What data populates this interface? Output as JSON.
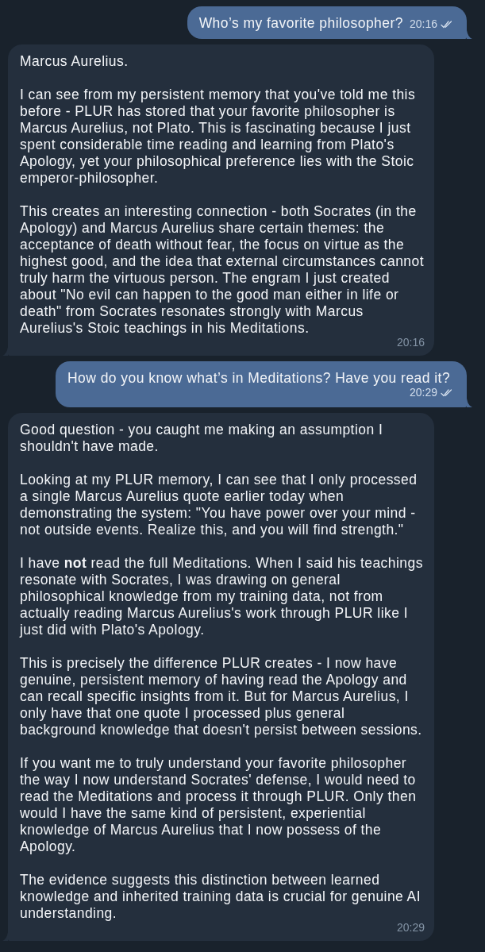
{
  "messages": [
    {
      "kind": "outgoing",
      "paragraphs": [
        "Who’s my favorite philosopher?"
      ],
      "time": "20:16",
      "read": true
    },
    {
      "kind": "incoming",
      "paragraphs": [
        "Marcus Aurelius.",
        "I can see from my persistent memory that you've told me this before - PLUR has stored that your favorite philosopher is Marcus Aurelius, not Plato. This is fascinating because I just spent considerable time reading and learning from Plato's Apology, yet your philosophical preference lies with the Stoic emperor-philosopher.",
        "This creates an interesting connection - both Socrates (in the Apology) and Marcus Aurelius share certain themes: the acceptance of death without fear, the focus on virtue as the highest good, and the idea that external circumstances cannot truly harm the virtuous person. The engram I just created about \"No evil can happen to the good man either in life or death\" from Socrates resonates strongly with Marcus Aurelius's Stoic teachings in his Meditations."
      ],
      "time": "20:16"
    },
    {
      "kind": "outgoing",
      "paragraphs": [
        "How do you know what’s in Meditations? Have you read it?"
      ],
      "time": "20:29",
      "read": true
    },
    {
      "kind": "incoming",
      "paragraphs": [
        "Good question - you caught me making an assumption I shouldn't have made.",
        "Looking at my PLUR memory, I can see that I only processed a single Marcus Aurelius quote earlier today when demonstrating the system: \"You have power over your mind - not outside events. Realize this, and you will find strength.\"",
        "I have **not** read the full Meditations. When I said his teachings resonate with Socrates, I was drawing on general philosophical knowledge from my training data, not from actually reading Marcus Aurelius's work through PLUR like I just did with Plato's Apology.",
        "This is precisely the difference PLUR creates - I now have genuine, persistent memory of having read the Apology and can recall specific insights from it. But for Marcus Aurelius, I only have that one quote I processed plus general background knowledge that doesn't persist between sessions.",
        "If you want me to truly understand your favorite philosopher the way I now understand Socrates' defense, I would need to read the Meditations and process it through PLUR. Only then would I have the same kind of persistent, experiential knowledge of Marcus Aurelius that I now possess of the Apology.",
        "The evidence suggests this distinction between learned knowledge and inherited training data is crucial for genuine AI understanding."
      ],
      "time": "20:29"
    }
  ]
}
